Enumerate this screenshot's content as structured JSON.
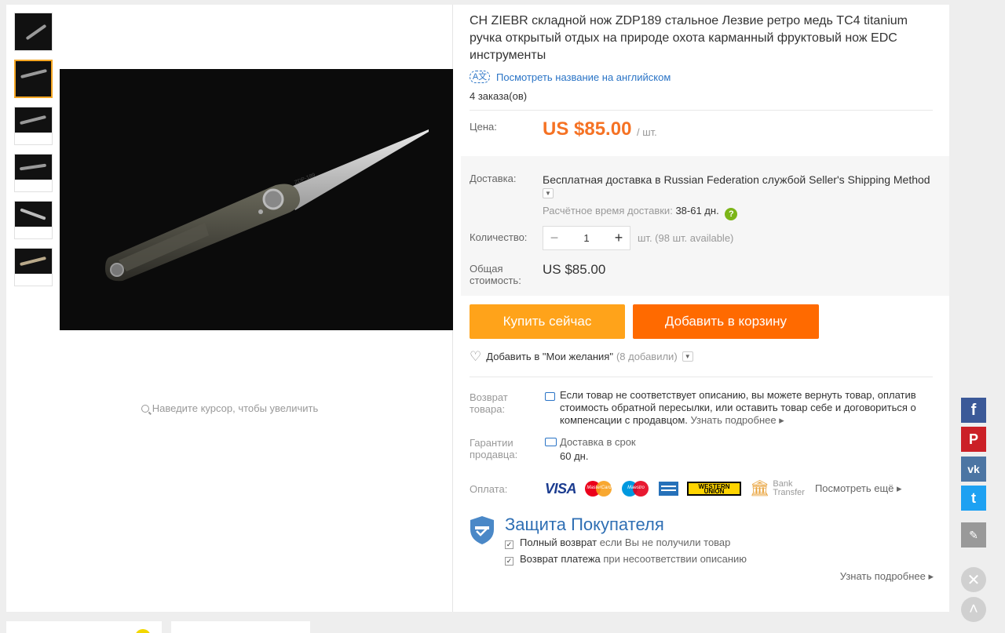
{
  "product": {
    "title": "CH ZIEBR складной нож ZDP189 стальное Лезвие ретро медь TC4 titanium ручка открытый отдых на природе охота карманный фруктовый нож EDC инструменты",
    "translate_link": "Посмотреть название на английском",
    "orders": "4 заказа(ов)",
    "zoom_hint": "Наведите курсор, чтобы увеличить",
    "blade_marking": "ZDP-189"
  },
  "price": {
    "label": "Цена:",
    "value": "US $85.00",
    "per_unit": "/ шт."
  },
  "shipping": {
    "label": "Доставка:",
    "free": "Бесплатная доставка в",
    "location": "Russian Federation",
    "by": "службой",
    "method": "Seller's Shipping Method",
    "time_label": "Расчётное время доставки:",
    "time_value": "38-61 дн.",
    "help": "?"
  },
  "quantity": {
    "label": "Количество:",
    "minus": "−",
    "value": "1",
    "plus": "+",
    "unit_text": "шт. (98 шт. available)"
  },
  "total": {
    "label": "Общая стоимость:",
    "value": "US $85.00"
  },
  "actions": {
    "buy_now": "Купить сейчас",
    "add_to_cart": "Добавить в корзину",
    "wishlist": "Добавить в \"Мои желания\"",
    "wishlist_count": "(8 добавили)"
  },
  "returns": {
    "label": "Возврат товара:",
    "text": "Если товар не соответствует описанию, вы можете вернуть товар, оплатив стоимость обратной пересылки, или оставить товар себе и договориться о компенсации с продавцом.",
    "more": "Узнать подробнее ▸"
  },
  "guarantee": {
    "label": "Гарантии продавца:",
    "line1": "Доставка в срок",
    "line2": "60 дн."
  },
  "payment": {
    "label": "Оплата:",
    "visa": "VISA",
    "mastercard": "MasterCard",
    "maestro": "Maestro",
    "western_union": "WESTERN UNION",
    "bank_transfer_1": "Bank",
    "bank_transfer_2": "Transfer",
    "see_more": "Посмотреть ещё ▸"
  },
  "protection": {
    "title": "Защита Покупателя",
    "item1_bold": "Полный возврат",
    "item1_rest": "если Вы не получили товар",
    "item2_bold": "Возврат платежа",
    "item2_rest": "при несоответствии описанию",
    "learn_more": "Узнать подробнее ▸"
  },
  "social": {
    "facebook": "f",
    "pinterest": "P",
    "vk": "vk",
    "twitter": "t"
  },
  "colors": {
    "price": "#f57224",
    "buy_now": "#ffa31a",
    "add_to_cart": "#ff6a00",
    "link": "#2a74c6",
    "facebook": "#3b5998",
    "pinterest": "#cb2027",
    "vk": "#4c75a3",
    "twitter": "#1da1f2"
  }
}
